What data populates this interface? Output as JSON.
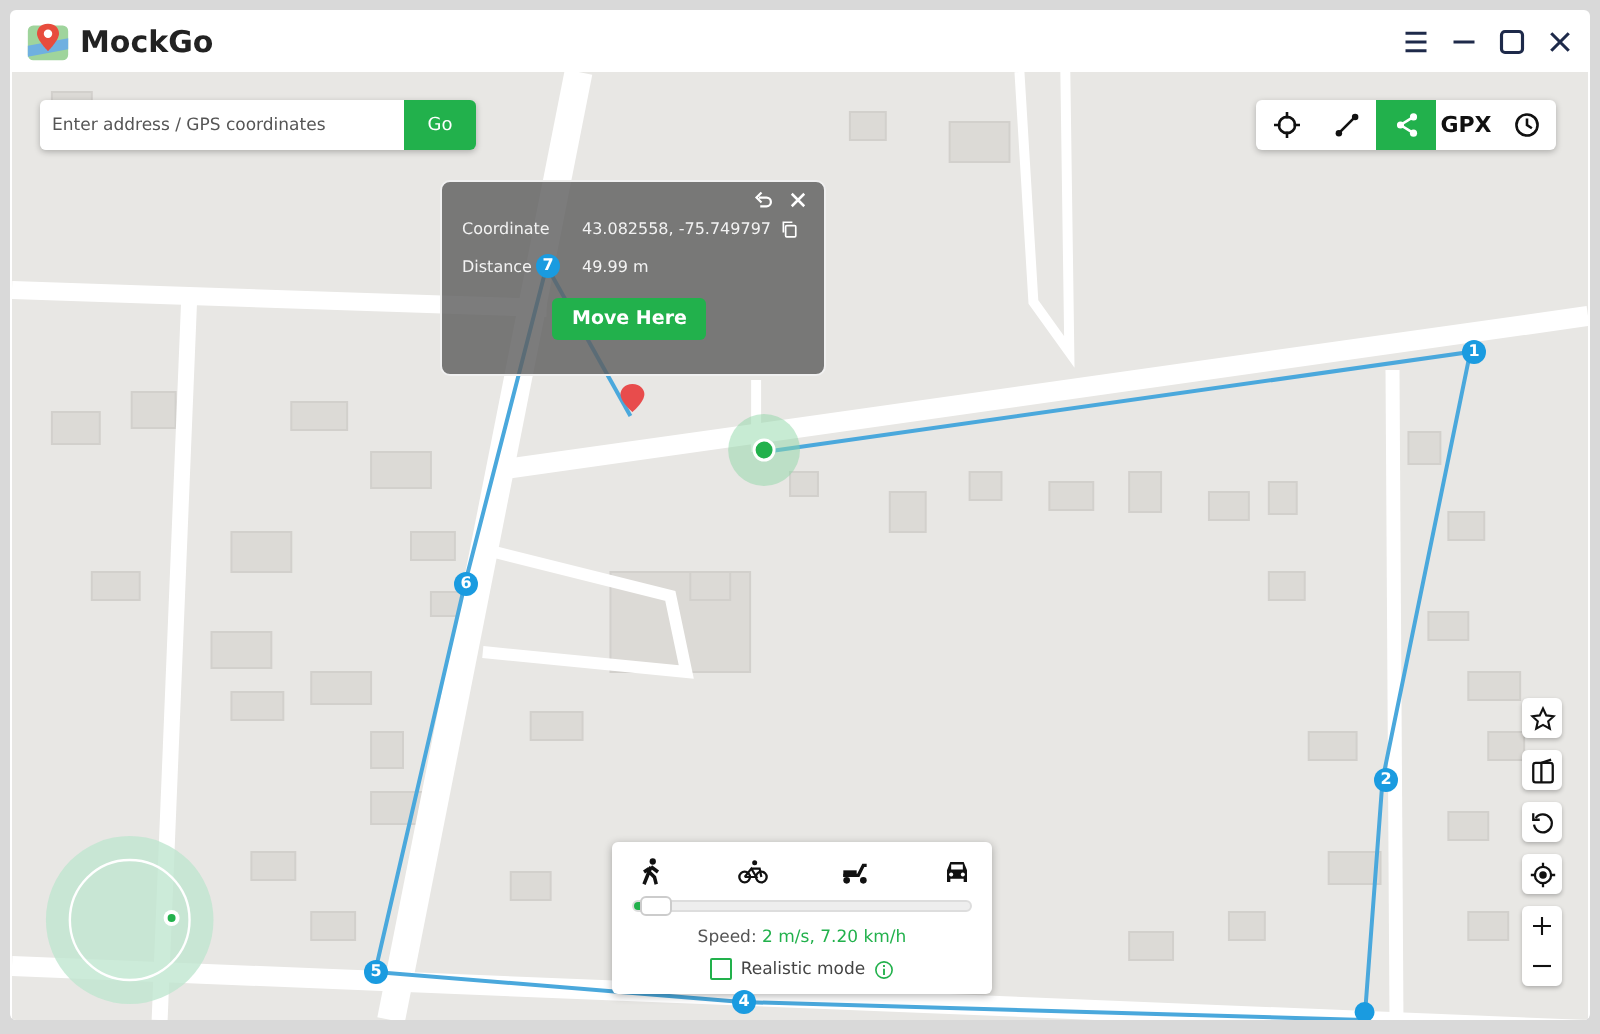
{
  "window": {
    "title": "MockGo"
  },
  "search": {
    "placeholder": "Enter address / GPS coordinates",
    "button": "Go"
  },
  "toolbar": [
    {
      "kind": "teleport",
      "selected": false
    },
    {
      "kind": "two-spot",
      "selected": false
    },
    {
      "kind": "multi-spot",
      "selected": true
    },
    {
      "kind": "gpx",
      "label": "GPX",
      "selected": false
    },
    {
      "kind": "history",
      "selected": false
    }
  ],
  "popup": {
    "rows": [
      {
        "label": "Coordinate",
        "value": "43.082558, -75.749797"
      },
      {
        "label": "Distance",
        "value": "49.99 m"
      }
    ],
    "button": "Move Here"
  },
  "route": {
    "waypoints": [
      "1",
      "2",
      "4",
      "5",
      "6",
      "7"
    ]
  },
  "speed_panel": {
    "modes": [
      {
        "kind": "walk"
      },
      {
        "kind": "bike"
      },
      {
        "kind": "scooter"
      },
      {
        "kind": "car"
      }
    ],
    "level": 0.03,
    "speed_label": "Speed:",
    "speed_value": "2 m/s, 7.20 km/h",
    "realistic": {
      "label": "Realistic mode",
      "checked": false
    }
  },
  "side_tools": [
    {
      "kind": "star"
    },
    {
      "kind": "device"
    },
    {
      "kind": "rotate"
    },
    {
      "kind": "locate"
    }
  ]
}
